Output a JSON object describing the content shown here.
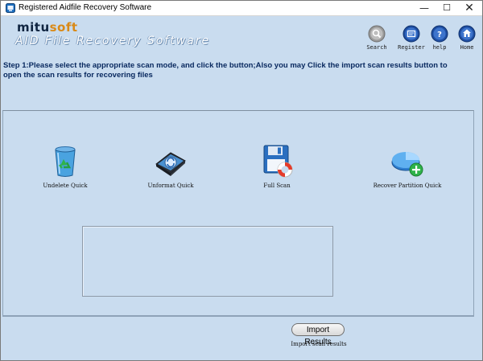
{
  "window": {
    "title": "Registered Aidfile Recovery Software",
    "controls": {
      "minimize": "—",
      "maximize": "☐",
      "close": "✕"
    }
  },
  "header": {
    "brand_mitu": "mitu",
    "brand_soft": "soft",
    "product_name": "AID File Recovery Software"
  },
  "toolbar": {
    "items": [
      {
        "label": "Search",
        "icon": "search-icon"
      },
      {
        "label": "Register",
        "icon": "register-icon"
      },
      {
        "label": "help",
        "icon": "help-icon"
      },
      {
        "label": "Home",
        "icon": "home-icon"
      }
    ]
  },
  "instructions": "Step 1:Please select the appropriate scan mode, and click the button;Also you may Click the import scan results button to open the scan results for recovering files",
  "scan_modes": [
    {
      "label": "Undelete Quick",
      "icon": "recycle-bin-icon"
    },
    {
      "label": "Unformat Quick",
      "icon": "drive-format-icon"
    },
    {
      "label": "Full Scan",
      "icon": "floppy-lifebuoy-icon"
    },
    {
      "label": "Recover Partition Quick",
      "icon": "partition-add-icon"
    }
  ],
  "import": {
    "button_label": "Import Results",
    "caption": "Import scan results"
  }
}
